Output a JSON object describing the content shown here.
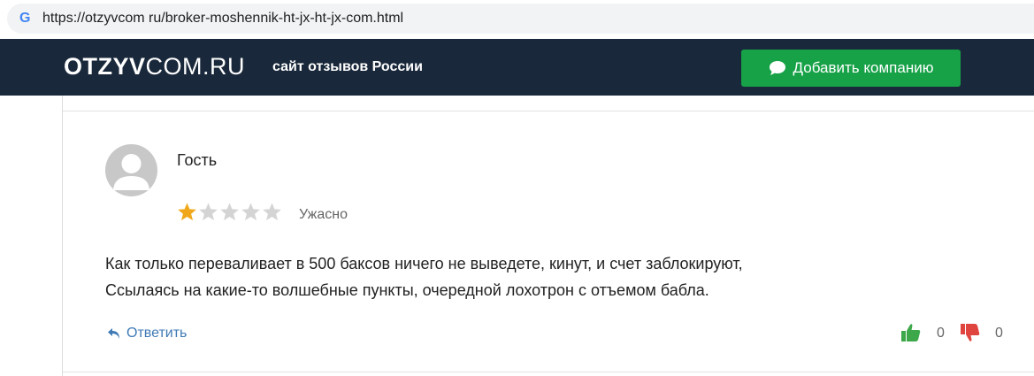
{
  "browser": {
    "url": "https://otzyvcom ru/broker-moshennik-ht-jx-ht-jx-com.html",
    "favicon": "google-g-icon"
  },
  "site": {
    "logo_bold": "OTZYV",
    "logo_thin": "COM.RU",
    "tagline": "сайт отзывов России",
    "add_button_label": "Добавить компанию",
    "add_button_icon": "chat-bubble-icon",
    "colors": {
      "header_bg": "#19283a",
      "button_bg": "#17a248",
      "link": "#3f7ab5",
      "star": "#f0a81a"
    }
  },
  "review": {
    "author": "Гость",
    "rating": 1,
    "rating_max": 5,
    "rating_label": "Ужасно",
    "text_lines": [
      "Как только переваливает в 500 баксов ничего не выведете, кинут, и счет заблокируют,",
      "Ссылаясь на какие-то волшебные пункты, очередной лохотрон с отъемом бабла."
    ],
    "reply_label": "Ответить",
    "likes": "0",
    "dislikes": "0"
  }
}
